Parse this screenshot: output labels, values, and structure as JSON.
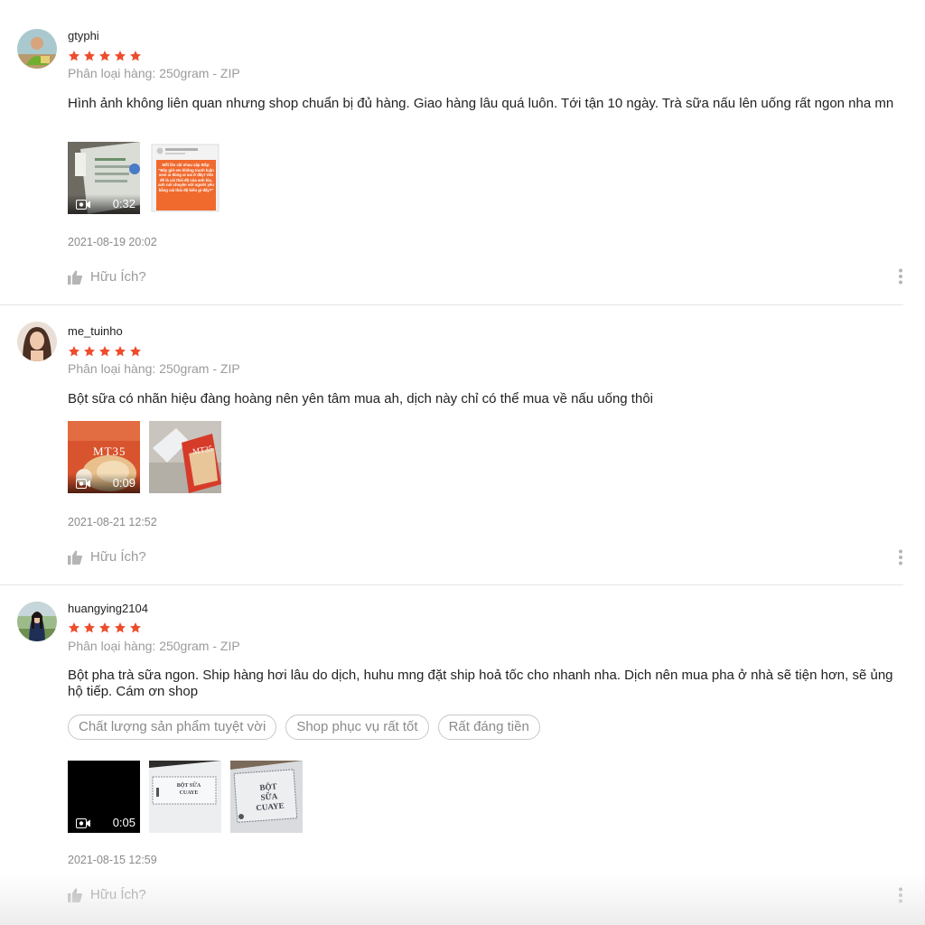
{
  "reviews": [
    {
      "username": "gtyphi",
      "rating": 5,
      "variation": "Phân loại hàng: 250gram - ZIP",
      "comment": "Hình ảnh không liên quan nhưng shop chuẩn bị đủ hàng. Giao hàng lâu quá luôn. Tới tận 10 ngày. Trà sữa nấu lên uống rất ngon nha mn",
      "video_duration": "0:32",
      "image_text": "Mỗi lần cãi nhau xập Bốp: \"Bây giờ em không tranh luận xem ai đúng ai sai ở đây! Vấn đề là cái thái độ của anh kìa, anh nói chuyện với người yêu bằng cái thái độ kiểu gì đấy?\"",
      "timestamp": "2021-08-19 20:02",
      "helpful_label": "Hữu Ích?"
    },
    {
      "username": "me_tuinho",
      "rating": 5,
      "variation": "Phân loại hàng: 250gram - ZIP",
      "comment": "Bột sữa có nhãn hiệu đàng hoàng nên yên tâm mua ah, dịch này chỉ có thể mua về nấu uống thôi",
      "video_duration": "0:09",
      "product_label": "MT35",
      "timestamp": "2021-08-21 12:52",
      "helpful_label": "Hữu Ích?"
    },
    {
      "username": "huangying2104",
      "rating": 5,
      "variation": "Phân loại hàng: 250gram - ZIP",
      "comment": "Bột pha trà sữa ngon. Ship hàng hơi lâu do dịch, huhu mng đặt ship hoả tốc cho nhanh nha. Dịch nên mua pha ở nhà sẽ tiện hơn, sẽ ủng hộ tiếp. Cám ơn shop",
      "tags": [
        "Chất lượng sản phẩm tuyệt vời",
        "Shop phục vụ rất tốt",
        "Rất đáng tiền"
      ],
      "video_duration": "0:05",
      "bag_label": "BỘT SỮA CUAYE",
      "timestamp": "2021-08-15 12:59",
      "helpful_label": "Hữu Ích?"
    }
  ],
  "colors": {
    "star": "#ee4d2d",
    "muted": "#9b9b9b",
    "divider": "#e5e5e5"
  }
}
